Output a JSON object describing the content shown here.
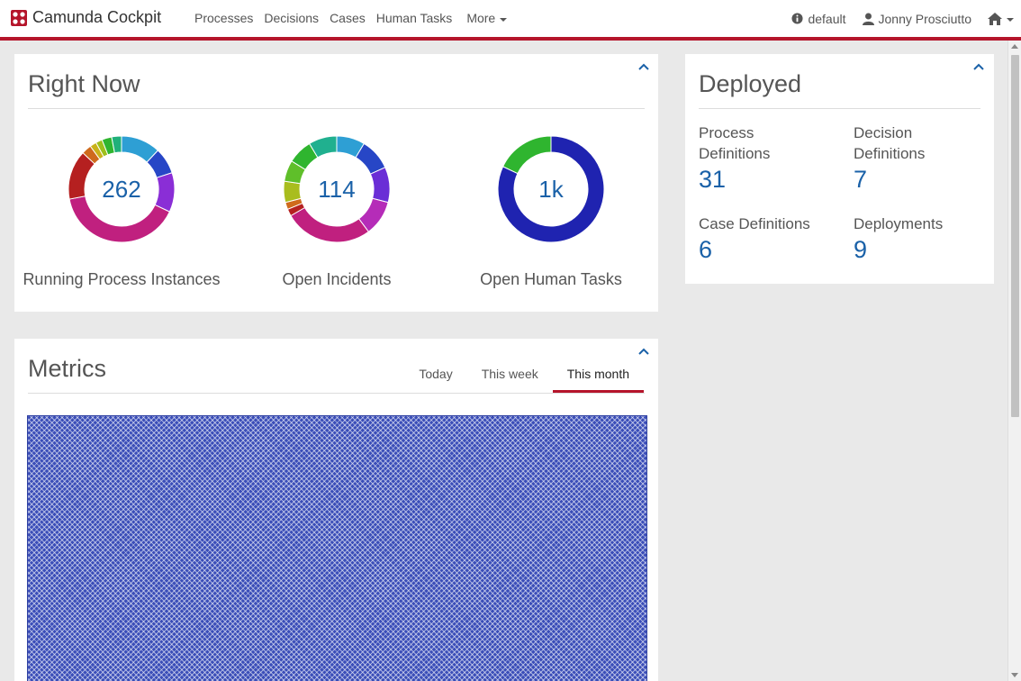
{
  "app": {
    "title": "Camunda Cockpit"
  },
  "nav": {
    "items": [
      "Processes",
      "Decisions",
      "Cases",
      "Human Tasks"
    ],
    "more_label": "More"
  },
  "user": {
    "engine": "default",
    "name": "Jonny Prosciutto"
  },
  "icons": {
    "engine": "info-circle-icon",
    "user": "user-icon",
    "home": "home-icon",
    "collapse": "chevron-up-icon"
  },
  "colors": {
    "brand": "#b5152b",
    "link": "#1a61a8"
  },
  "right_now": {
    "title": "Right Now",
    "cards": [
      {
        "value": "262",
        "label": "Running Process Instances",
        "segments": [
          {
            "value": 12,
            "color": "#2e9fd4"
          },
          {
            "value": 8,
            "color": "#2746c6"
          },
          {
            "value": 12,
            "color": "#8a2ed6"
          },
          {
            "value": 40,
            "color": "#c0207f"
          },
          {
            "value": 15,
            "color": "#b52020"
          },
          {
            "value": 3,
            "color": "#cf6a1c"
          },
          {
            "value": 2,
            "color": "#c9b21a"
          },
          {
            "value": 2,
            "color": "#9ebf1c"
          },
          {
            "value": 3,
            "color": "#2fb52f"
          },
          {
            "value": 3,
            "color": "#20b07a"
          }
        ]
      },
      {
        "value": "114",
        "label": "Open Incidents",
        "segments": [
          {
            "value": 8,
            "color": "#2e9fd4"
          },
          {
            "value": 9,
            "color": "#2746c6"
          },
          {
            "value": 10,
            "color": "#6a2ed6"
          },
          {
            "value": 10,
            "color": "#b52cb8"
          },
          {
            "value": 25,
            "color": "#c0207f"
          },
          {
            "value": 2,
            "color": "#b52020"
          },
          {
            "value": 2,
            "color": "#cf6a1c"
          },
          {
            "value": 6,
            "color": "#a9bd1e"
          },
          {
            "value": 6,
            "color": "#5fbf2a"
          },
          {
            "value": 7,
            "color": "#2fb52f"
          },
          {
            "value": 8,
            "color": "#20b08f"
          }
        ]
      },
      {
        "value": "1k",
        "label": "Open Human Tasks",
        "segments": [
          {
            "value": 82,
            "color": "#1f23b0"
          },
          {
            "value": 18,
            "color": "#2fb52f"
          }
        ]
      }
    ]
  },
  "deployed": {
    "title": "Deployed",
    "stats": [
      {
        "label": "Process Definitions",
        "value": "31"
      },
      {
        "label": "Decision Definitions",
        "value": "7"
      },
      {
        "label": "Case Definitions",
        "value": "6"
      },
      {
        "label": "Deployments",
        "value": "9"
      }
    ]
  },
  "metrics": {
    "title": "Metrics",
    "tabs": [
      {
        "label": "Today",
        "active": false
      },
      {
        "label": "This week",
        "active": false
      },
      {
        "label": "This month",
        "active": true
      }
    ]
  }
}
